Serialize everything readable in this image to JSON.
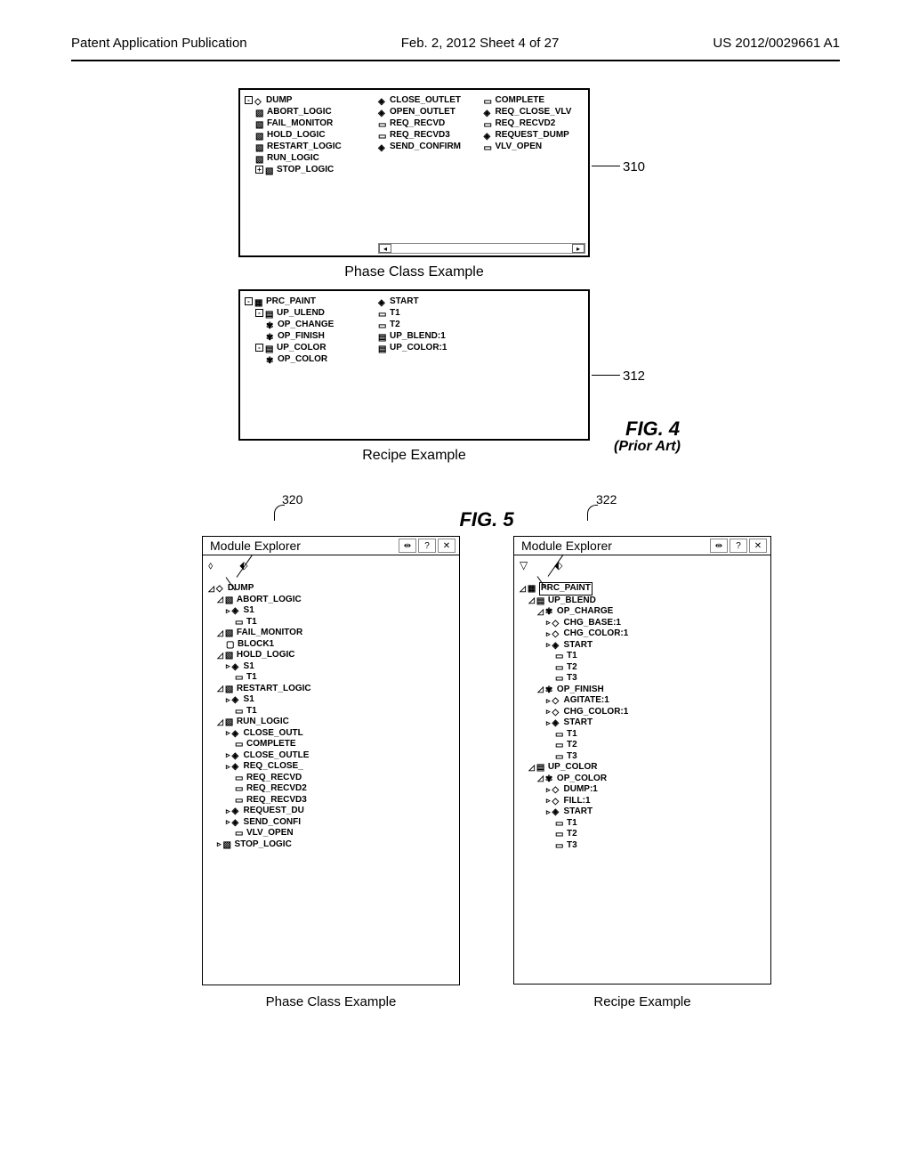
{
  "header": {
    "left": "Patent Application Publication",
    "center": "Feb. 2, 2012   Sheet 4 of 27",
    "right": "US 2012/0029661 A1"
  },
  "refs": {
    "r310": "310",
    "r312": "312",
    "r320": "320",
    "r322": "322"
  },
  "figLabels": {
    "fig4": "FIG. 4",
    "fig4sub": "(Prior Art)",
    "fig5": "FIG. 5"
  },
  "captions": {
    "phaseClass": "Phase Class Example",
    "recipe": "Recipe Example"
  },
  "explorerTitle": "Module Explorer",
  "panel310": {
    "leftTree": [
      {
        "indent": 0,
        "expand": "-",
        "icon": "◇",
        "text": "DUMP"
      },
      {
        "indent": 1,
        "icon": "▧",
        "text": "ABORT_LOGIC"
      },
      {
        "indent": 1,
        "icon": "▧",
        "text": "FAIL_MONITOR"
      },
      {
        "indent": 1,
        "icon": "▧",
        "text": "HOLD_LOGIC"
      },
      {
        "indent": 1,
        "icon": "▧",
        "text": "RESTART_LOGIC"
      },
      {
        "indent": 1,
        "icon": "▧",
        "text": "RUN_LOGIC"
      },
      {
        "indent": 1,
        "expand": "+",
        "icon": "▧",
        "text": "STOP_LOGIC"
      }
    ],
    "rightItems": [
      {
        "icon": "◈",
        "text": "CLOSE_OUTLET"
      },
      {
        "icon": "▭",
        "text": "COMPLETE"
      },
      {
        "icon": "◈",
        "text": "OPEN_OUTLET"
      },
      {
        "icon": "◈",
        "text": "REQ_CLOSE_VLV"
      },
      {
        "icon": "▭",
        "text": "REQ_RECVD"
      },
      {
        "icon": "▭",
        "text": "REQ_RECVD2"
      },
      {
        "icon": "▭",
        "text": "REQ_RECVD3"
      },
      {
        "icon": "◈",
        "text": "REQUEST_DUMP"
      },
      {
        "icon": "◈",
        "text": "SEND_CONFIRM"
      },
      {
        "icon": "▭",
        "text": "VLV_OPEN"
      }
    ]
  },
  "panel312": {
    "leftTree": [
      {
        "indent": 0,
        "expand": "-",
        "icon": "▦",
        "text": "PRC_PAINT"
      },
      {
        "indent": 1,
        "expand": "-",
        "icon": "▤",
        "text": "UP_ULEND"
      },
      {
        "indent": 2,
        "icon": "✾",
        "text": "OP_CHANGE"
      },
      {
        "indent": 2,
        "icon": "✾",
        "text": "OP_FINISH"
      },
      {
        "indent": 1,
        "expand": "-",
        "icon": "▤",
        "text": "UP_COLOR"
      },
      {
        "indent": 2,
        "icon": "✾",
        "text": "OP_COLOR"
      }
    ],
    "rightItems": [
      {
        "icon": "◈",
        "text": "START"
      },
      {
        "icon": "▭",
        "text": "T1"
      },
      {
        "icon": "▭",
        "text": "T2"
      },
      {
        "icon": "▤",
        "text": "UP_BLEND:1"
      },
      {
        "icon": "▤",
        "text": "UP_COLOR:1"
      },
      {
        "icon": "",
        "text": ""
      }
    ]
  },
  "panel320": {
    "tree": [
      {
        "indent": 0,
        "pre": "◿",
        "icon": "◇",
        "text": "DUMP"
      },
      {
        "indent": 1,
        "pre": "◿",
        "icon": "▧",
        "text": "ABORT_LOGIC"
      },
      {
        "indent": 2,
        "pre": "▹",
        "icon": "◈",
        "text": "S1"
      },
      {
        "indent": 3,
        "icon": "▭",
        "text": "T1"
      },
      {
        "indent": 1,
        "pre": "◿",
        "icon": "▧",
        "text": "FAIL_MONITOR"
      },
      {
        "indent": 2,
        "icon": "▢",
        "text": "BLOCK1"
      },
      {
        "indent": 1,
        "pre": "◿",
        "icon": "▧",
        "text": "HOLD_LOGIC"
      },
      {
        "indent": 2,
        "pre": "▹",
        "icon": "◈",
        "text": "S1"
      },
      {
        "indent": 3,
        "icon": "▭",
        "text": "T1"
      },
      {
        "indent": 1,
        "pre": "◿",
        "icon": "▧",
        "text": "RESTART_LOGIC"
      },
      {
        "indent": 2,
        "pre": "▹",
        "icon": "◈",
        "text": "S1"
      },
      {
        "indent": 3,
        "icon": "▭",
        "text": "T1"
      },
      {
        "indent": 1,
        "pre": "◿",
        "icon": "▧",
        "text": "RUN_LOGIC"
      },
      {
        "indent": 2,
        "pre": "▹",
        "icon": "◈",
        "text": "CLOSE_OUTL"
      },
      {
        "indent": 3,
        "icon": "▭",
        "text": "COMPLETE"
      },
      {
        "indent": 2,
        "pre": "▹",
        "icon": "◈",
        "text": "CLOSE_OUTLE"
      },
      {
        "indent": 2,
        "pre": "▹",
        "icon": "◈",
        "text": "REQ_CLOSE_"
      },
      {
        "indent": 3,
        "icon": "▭",
        "text": "REQ_RECVD"
      },
      {
        "indent": 3,
        "icon": "▭",
        "text": "REQ_RECVD2"
      },
      {
        "indent": 3,
        "icon": "▭",
        "text": "REQ_RECVD3"
      },
      {
        "indent": 2,
        "pre": "▹",
        "icon": "◈",
        "text": "REQUEST_DU"
      },
      {
        "indent": 2,
        "pre": "▹",
        "icon": "◈",
        "text": "SEND_CONFI"
      },
      {
        "indent": 3,
        "icon": "▭",
        "text": "VLV_OPEN"
      },
      {
        "indent": 1,
        "pre": "▹",
        "icon": "▧",
        "text": "STOP_LOGIC"
      }
    ]
  },
  "panel322": {
    "tree": [
      {
        "indent": 0,
        "pre": "◿",
        "icon": "▦",
        "text": "PRC_PAINT",
        "hl": true
      },
      {
        "indent": 1,
        "pre": "◿",
        "icon": "▤",
        "text": "UP_BLEND"
      },
      {
        "indent": 2,
        "pre": "◿",
        "icon": "✾",
        "text": "OP_CHARGE"
      },
      {
        "indent": 3,
        "pre": "▹",
        "icon": "◇",
        "text": "CHG_BASE:1"
      },
      {
        "indent": 3,
        "pre": "▹",
        "icon": "◇",
        "text": "CHG_COLOR:1"
      },
      {
        "indent": 3,
        "pre": "▹",
        "icon": "◈",
        "text": "START"
      },
      {
        "indent": 4,
        "icon": "▭",
        "text": "T1"
      },
      {
        "indent": 4,
        "icon": "▭",
        "text": "T2"
      },
      {
        "indent": 4,
        "icon": "▭",
        "text": "T3"
      },
      {
        "indent": 2,
        "pre": "◿",
        "icon": "✾",
        "text": "OP_FINISH"
      },
      {
        "indent": 3,
        "pre": "▹",
        "icon": "◇",
        "text": "AGITATE:1"
      },
      {
        "indent": 3,
        "pre": "▹",
        "icon": "◇",
        "text": "CHG_COLOR:1"
      },
      {
        "indent": 3,
        "pre": "▹",
        "icon": "◈",
        "text": "START"
      },
      {
        "indent": 4,
        "icon": "▭",
        "text": "T1"
      },
      {
        "indent": 4,
        "icon": "▭",
        "text": "T2"
      },
      {
        "indent": 4,
        "icon": "▭",
        "text": "T3"
      },
      {
        "indent": 1,
        "pre": "◿",
        "icon": "▤",
        "text": "UP_COLOR"
      },
      {
        "indent": 2,
        "pre": "◿",
        "icon": "✾",
        "text": "OP_COLOR"
      },
      {
        "indent": 3,
        "pre": "▹",
        "icon": "◇",
        "text": "DUMP:1"
      },
      {
        "indent": 3,
        "pre": "▹",
        "icon": "◇",
        "text": "FILL:1"
      },
      {
        "indent": 3,
        "pre": "▹",
        "icon": "◈",
        "text": "START"
      },
      {
        "indent": 4,
        "icon": "▭",
        "text": "T1"
      },
      {
        "indent": 4,
        "icon": "▭",
        "text": "T2"
      },
      {
        "indent": 4,
        "icon": "▭",
        "text": "T3"
      }
    ]
  }
}
